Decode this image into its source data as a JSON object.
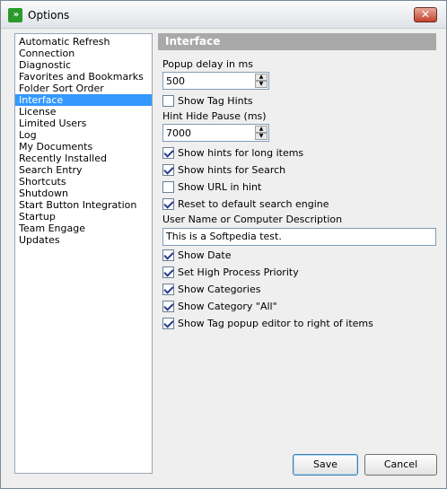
{
  "window": {
    "title": "Options",
    "close_glyph": "✕",
    "app_icon": "forward-arrows-icon",
    "app_icon_glyph": "»"
  },
  "sidebar": {
    "items": [
      "Automatic Refresh",
      "Connection",
      "Diagnostic",
      "Favorites and Bookmarks",
      "Folder Sort Order",
      "Interface",
      "License",
      "Limited Users",
      "Log",
      "My Documents",
      "Recently Installed",
      "Search Entry",
      "Shortcuts",
      "Shutdown",
      "Start Button Integration",
      "Startup",
      "Team Engage",
      "Updates"
    ],
    "selected_index": 5
  },
  "panel": {
    "header": "Interface",
    "popup_delay_label": "Popup delay in ms",
    "popup_delay_value": "500",
    "show_tag_hints": {
      "label": "Show Tag Hints",
      "checked": false
    },
    "hint_hide_label": "Hint Hide Pause (ms)",
    "hint_hide_value": "7000",
    "show_hints_long": {
      "label": "Show hints for long items",
      "checked": true
    },
    "show_hints_search": {
      "label": "Show hints for Search",
      "checked": true
    },
    "show_url_hint": {
      "label": "Show URL in hint",
      "checked": false
    },
    "reset_search": {
      "label": "Reset to default search engine",
      "checked": true
    },
    "user_name_label": "User Name or Computer Description",
    "user_name_value": "This is a Softpedia test.",
    "show_date": {
      "label": "Show Date",
      "checked": true
    },
    "high_priority": {
      "label": "Set High Process Priority",
      "checked": true
    },
    "show_categories": {
      "label": "Show Categories",
      "checked": true
    },
    "show_category_all": {
      "label": "Show Category \"All\"",
      "checked": true
    },
    "show_tag_popup": {
      "label": "Show Tag popup editor to right of items",
      "checked": true
    }
  },
  "buttons": {
    "save": "Save",
    "cancel": "Cancel"
  },
  "colors": {
    "selection": "#3399ff",
    "header_bg": "#a9a9a9",
    "close": "#c3422b"
  }
}
